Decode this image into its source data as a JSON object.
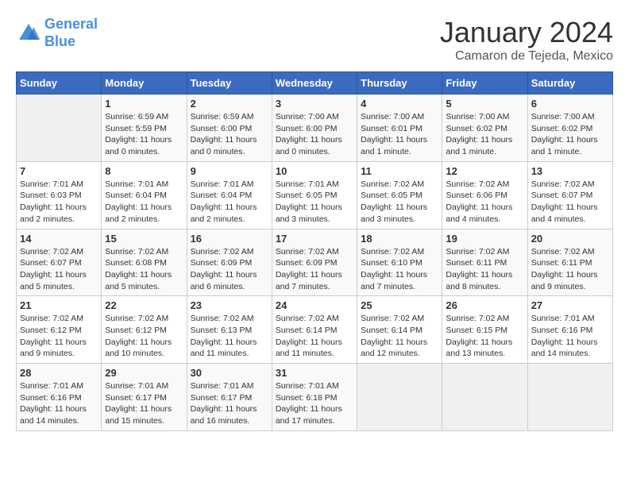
{
  "header": {
    "logo_line1": "General",
    "logo_line2": "Blue",
    "month": "January 2024",
    "location": "Camaron de Tejeda, Mexico"
  },
  "days_of_week": [
    "Sunday",
    "Monday",
    "Tuesday",
    "Wednesday",
    "Thursday",
    "Friday",
    "Saturday"
  ],
  "weeks": [
    [
      {
        "num": "",
        "info": ""
      },
      {
        "num": "1",
        "info": "Sunrise: 6:59 AM\nSunset: 5:59 PM\nDaylight: 11 hours\nand 0 minutes."
      },
      {
        "num": "2",
        "info": "Sunrise: 6:59 AM\nSunset: 6:00 PM\nDaylight: 11 hours\nand 0 minutes."
      },
      {
        "num": "3",
        "info": "Sunrise: 7:00 AM\nSunset: 6:00 PM\nDaylight: 11 hours\nand 0 minutes."
      },
      {
        "num": "4",
        "info": "Sunrise: 7:00 AM\nSunset: 6:01 PM\nDaylight: 11 hours\nand 1 minute."
      },
      {
        "num": "5",
        "info": "Sunrise: 7:00 AM\nSunset: 6:02 PM\nDaylight: 11 hours\nand 1 minute."
      },
      {
        "num": "6",
        "info": "Sunrise: 7:00 AM\nSunset: 6:02 PM\nDaylight: 11 hours\nand 1 minute."
      }
    ],
    [
      {
        "num": "7",
        "info": "Sunrise: 7:01 AM\nSunset: 6:03 PM\nDaylight: 11 hours\nand 2 minutes."
      },
      {
        "num": "8",
        "info": "Sunrise: 7:01 AM\nSunset: 6:04 PM\nDaylight: 11 hours\nand 2 minutes."
      },
      {
        "num": "9",
        "info": "Sunrise: 7:01 AM\nSunset: 6:04 PM\nDaylight: 11 hours\nand 2 minutes."
      },
      {
        "num": "10",
        "info": "Sunrise: 7:01 AM\nSunset: 6:05 PM\nDaylight: 11 hours\nand 3 minutes."
      },
      {
        "num": "11",
        "info": "Sunrise: 7:02 AM\nSunset: 6:05 PM\nDaylight: 11 hours\nand 3 minutes."
      },
      {
        "num": "12",
        "info": "Sunrise: 7:02 AM\nSunset: 6:06 PM\nDaylight: 11 hours\nand 4 minutes."
      },
      {
        "num": "13",
        "info": "Sunrise: 7:02 AM\nSunset: 6:07 PM\nDaylight: 11 hours\nand 4 minutes."
      }
    ],
    [
      {
        "num": "14",
        "info": "Sunrise: 7:02 AM\nSunset: 6:07 PM\nDaylight: 11 hours\nand 5 minutes."
      },
      {
        "num": "15",
        "info": "Sunrise: 7:02 AM\nSunset: 6:08 PM\nDaylight: 11 hours\nand 5 minutes."
      },
      {
        "num": "16",
        "info": "Sunrise: 7:02 AM\nSunset: 6:09 PM\nDaylight: 11 hours\nand 6 minutes."
      },
      {
        "num": "17",
        "info": "Sunrise: 7:02 AM\nSunset: 6:09 PM\nDaylight: 11 hours\nand 7 minutes."
      },
      {
        "num": "18",
        "info": "Sunrise: 7:02 AM\nSunset: 6:10 PM\nDaylight: 11 hours\nand 7 minutes."
      },
      {
        "num": "19",
        "info": "Sunrise: 7:02 AM\nSunset: 6:11 PM\nDaylight: 11 hours\nand 8 minutes."
      },
      {
        "num": "20",
        "info": "Sunrise: 7:02 AM\nSunset: 6:11 PM\nDaylight: 11 hours\nand 9 minutes."
      }
    ],
    [
      {
        "num": "21",
        "info": "Sunrise: 7:02 AM\nSunset: 6:12 PM\nDaylight: 11 hours\nand 9 minutes."
      },
      {
        "num": "22",
        "info": "Sunrise: 7:02 AM\nSunset: 6:12 PM\nDaylight: 11 hours\nand 10 minutes."
      },
      {
        "num": "23",
        "info": "Sunrise: 7:02 AM\nSunset: 6:13 PM\nDaylight: 11 hours\nand 11 minutes."
      },
      {
        "num": "24",
        "info": "Sunrise: 7:02 AM\nSunset: 6:14 PM\nDaylight: 11 hours\nand 11 minutes."
      },
      {
        "num": "25",
        "info": "Sunrise: 7:02 AM\nSunset: 6:14 PM\nDaylight: 11 hours\nand 12 minutes."
      },
      {
        "num": "26",
        "info": "Sunrise: 7:02 AM\nSunset: 6:15 PM\nDaylight: 11 hours\nand 13 minutes."
      },
      {
        "num": "27",
        "info": "Sunrise: 7:01 AM\nSunset: 6:16 PM\nDaylight: 11 hours\nand 14 minutes."
      }
    ],
    [
      {
        "num": "28",
        "info": "Sunrise: 7:01 AM\nSunset: 6:16 PM\nDaylight: 11 hours\nand 14 minutes."
      },
      {
        "num": "29",
        "info": "Sunrise: 7:01 AM\nSunset: 6:17 PM\nDaylight: 11 hours\nand 15 minutes."
      },
      {
        "num": "30",
        "info": "Sunrise: 7:01 AM\nSunset: 6:17 PM\nDaylight: 11 hours\nand 16 minutes."
      },
      {
        "num": "31",
        "info": "Sunrise: 7:01 AM\nSunset: 6:18 PM\nDaylight: 11 hours\nand 17 minutes."
      },
      {
        "num": "",
        "info": ""
      },
      {
        "num": "",
        "info": ""
      },
      {
        "num": "",
        "info": ""
      }
    ]
  ]
}
